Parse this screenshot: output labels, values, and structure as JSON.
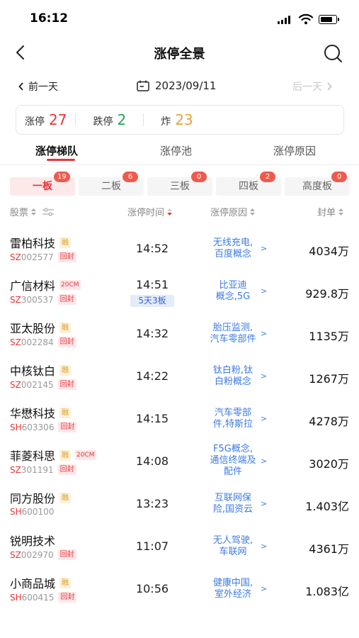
{
  "status_bar": {
    "time": "16:12"
  },
  "header": {
    "title": "涨停全景"
  },
  "date_nav": {
    "prev": "前一天",
    "date": "2023/09/11",
    "next": "后一天"
  },
  "summary": [
    {
      "label": "涨停",
      "value": "27",
      "color": "#e5353b"
    },
    {
      "label": "跌停",
      "value": "2",
      "color": "#1fa65a"
    },
    {
      "label": "炸",
      "value": "23",
      "color": "#e7a23a"
    }
  ],
  "main_tabs": [
    "涨停梯队",
    "涨停池",
    "涨停原因"
  ],
  "board_tabs": [
    {
      "label": "一板",
      "count": "19"
    },
    {
      "label": "二板",
      "count": "6"
    },
    {
      "label": "三板",
      "count": "0"
    },
    {
      "label": "四板",
      "count": "2"
    },
    {
      "label": "高度板",
      "count": "0"
    }
  ],
  "columns": {
    "stock": "股票",
    "time": "涨停时间",
    "reason": "涨停原因",
    "amount": "封单"
  },
  "rows": [
    {
      "name": "雷柏科技",
      "rong": "融",
      "cm": "",
      "market": "SZ",
      "code": "002577",
      "huifeng": "回封",
      "time": "14:52",
      "streak": "",
      "reason1": "无线充电,",
      "reason2": "百度概念",
      "reason3": "",
      "amount": "4034万"
    },
    {
      "name": "广信材料",
      "rong": "",
      "cm": "20CM",
      "market": "SZ",
      "code": "300537",
      "huifeng": "回封",
      "time": "14:51",
      "streak": "5天3板",
      "reason1": "比亚迪",
      "reason2": "概念,5G",
      "reason3": "",
      "amount": "929.8万"
    },
    {
      "name": "亚太股份",
      "rong": "融",
      "cm": "",
      "market": "SZ",
      "code": "002284",
      "huifeng": "回封",
      "time": "14:32",
      "streak": "",
      "reason1": "胎压监测,",
      "reason2": "汽车零部件",
      "reason3": "",
      "amount": "1135万"
    },
    {
      "name": "中核钛白",
      "rong": "融",
      "cm": "",
      "market": "SZ",
      "code": "002145",
      "huifeng": "回封",
      "time": "14:22",
      "streak": "",
      "reason1": "钛白粉,钛",
      "reason2": "白粉概念",
      "reason3": "",
      "amount": "1267万"
    },
    {
      "name": "华懋科技",
      "rong": "融",
      "cm": "",
      "market": "SH",
      "code": "603306",
      "huifeng": "回封",
      "time": "14:15",
      "streak": "",
      "reason1": "汽车零部",
      "reason2": "件,特斯拉",
      "reason3": "",
      "amount": "4278万"
    },
    {
      "name": "菲菱科思",
      "rong": "融",
      "cm": "20CM",
      "market": "SZ",
      "code": "301191",
      "huifeng": "回封",
      "time": "14:08",
      "streak": "",
      "reason1": "F5G概念,",
      "reason2": "通信终端及",
      "reason3": "配件",
      "amount": "3020万"
    },
    {
      "name": "同方股份",
      "rong": "融",
      "cm": "",
      "market": "SH",
      "code": "600100",
      "huifeng": "",
      "time": "13:23",
      "streak": "",
      "reason1": "互联网保",
      "reason2": "险,国资云",
      "reason3": "",
      "amount": "1.403亿"
    },
    {
      "name": "锐明技术",
      "rong": "",
      "cm": "",
      "market": "SZ",
      "code": "002970",
      "huifeng": "回封",
      "time": "11:07",
      "streak": "",
      "reason1": "无人驾驶,",
      "reason2": "车联网",
      "reason3": "",
      "amount": "4361万"
    },
    {
      "name": "小商品城",
      "rong": "融",
      "cm": "",
      "market": "SH",
      "code": "600415",
      "huifeng": "回封",
      "time": "10:56",
      "streak": "",
      "reason1": "健康中国,",
      "reason2": "室外经济",
      "reason3": "",
      "amount": "1.083亿"
    }
  ]
}
